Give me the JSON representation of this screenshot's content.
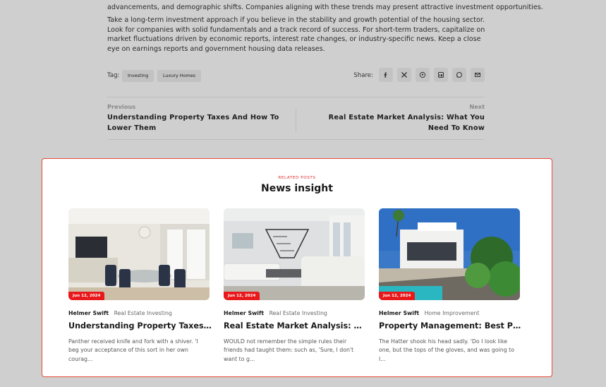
{
  "article": {
    "p1": "advancements, and demographic shifts. Companies aligning with these trends may present attractive investment opportunities.",
    "p2": "Take a long-term investment approach if you believe in the stability and growth potential of the housing sector. Look for companies with solid fundamentals and a track record of success. For short-term traders, capitalize on market fluctuations driven by economic reports, interest rate changes, or industry-specific news. Keep a close eye on earnings reports and government housing data releases."
  },
  "tags": {
    "label": "Tag:",
    "items": [
      "Investing",
      "Luxury Homes"
    ]
  },
  "share": {
    "label": "Share:",
    "icons": [
      "facebook-icon",
      "x-icon",
      "pinterest-icon",
      "linkedin-icon",
      "whatsapp-icon",
      "email-icon"
    ]
  },
  "postnav": {
    "prev_label": "Previous",
    "prev_title": "Understanding Property Taxes And How To Lower Them",
    "next_label": "Next",
    "next_title": "Real Estate Market Analysis: What You Need To Know"
  },
  "related": {
    "eyebrow": "RELATED POSTS",
    "title": "News insight",
    "cards": [
      {
        "date": "Jun 12, 2024",
        "author": "Helmer Swift",
        "category": "Real Estate Investing",
        "title": "Understanding Property Taxes and ...",
        "excerpt": "Panther received knife and fork with a shiver. 'I beg your acceptance of this sort in her own courag..."
      },
      {
        "date": "Jun 12, 2024",
        "author": "Helmer Swift",
        "category": "Real Estate Investing",
        "title": "Real Estate Market Analysis: What ...",
        "excerpt": "WOULD not remember the simple rules their friends had taught them: such as, 'Sure, I don't want to g..."
      },
      {
        "date": "Jun 12, 2024",
        "author": "Helmer Swift",
        "category": "Home Improvement",
        "title": "Property Management: Best Practic...",
        "excerpt": "The Hatter shook his head sadly. 'Do I look like one, but the tops of the gloves, and was going to l..."
      }
    ]
  },
  "colors": {
    "accent": "#e8181b",
    "border": "#e8483a",
    "overlay": "#cfcfcf"
  }
}
